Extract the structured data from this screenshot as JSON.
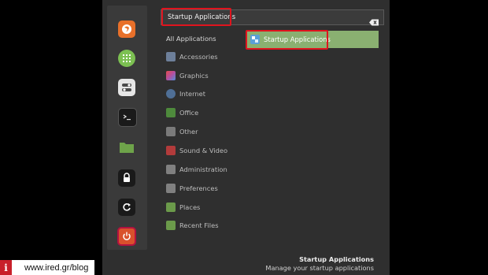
{
  "search": {
    "value": "Startup Applications"
  },
  "categories": [
    {
      "label": "All Applications",
      "icon": "none",
      "active": true
    },
    {
      "label": "Accessories",
      "icon": "accessories-icon",
      "color": "#6d7f9a"
    },
    {
      "label": "Graphics",
      "icon": "graphics-icon",
      "color": "#b44fa0"
    },
    {
      "label": "Internet",
      "icon": "internet-icon",
      "color": "#4f6f96"
    },
    {
      "label": "Office",
      "icon": "office-icon",
      "color": "#4e8a3c"
    },
    {
      "label": "Other",
      "icon": "other-icon",
      "color": "#7a7a7a"
    },
    {
      "label": "Sound & Video",
      "icon": "sound-video-icon",
      "color": "#b23b3b"
    },
    {
      "label": "Administration",
      "icon": "administration-icon",
      "color": "#808080"
    },
    {
      "label": "Preferences",
      "icon": "preferences-icon",
      "color": "#808080"
    },
    {
      "label": "Places",
      "icon": "folder-icon",
      "color": "#6b9a4a"
    },
    {
      "label": "Recent Files",
      "icon": "folder-icon",
      "color": "#6b9a4a"
    }
  ],
  "results": [
    {
      "label": "Startup Applications",
      "icon": "startup-applications-icon"
    }
  ],
  "status": {
    "title": "Startup Applications",
    "description": "Manage your startup applications"
  },
  "favorites": [
    {
      "icon": "firefox-icon",
      "color": "#e8702a"
    },
    {
      "icon": "software-manager-icon",
      "color": "#7cc052"
    },
    {
      "icon": "settings-toggle-icon",
      "color": "#d8d8d8"
    },
    {
      "icon": "terminal-icon",
      "color": "#1a1a1a"
    },
    {
      "icon": "files-folder-icon",
      "color": "#6ea34a"
    },
    {
      "icon": "lock-icon",
      "color": "#1a1a1a"
    },
    {
      "icon": "logout-icon",
      "color": "#1a1a1a"
    },
    {
      "icon": "power-icon",
      "color": "#d9512c"
    }
  ],
  "watermark": {
    "badge": "i",
    "text": "www.ired.gr/blog"
  }
}
